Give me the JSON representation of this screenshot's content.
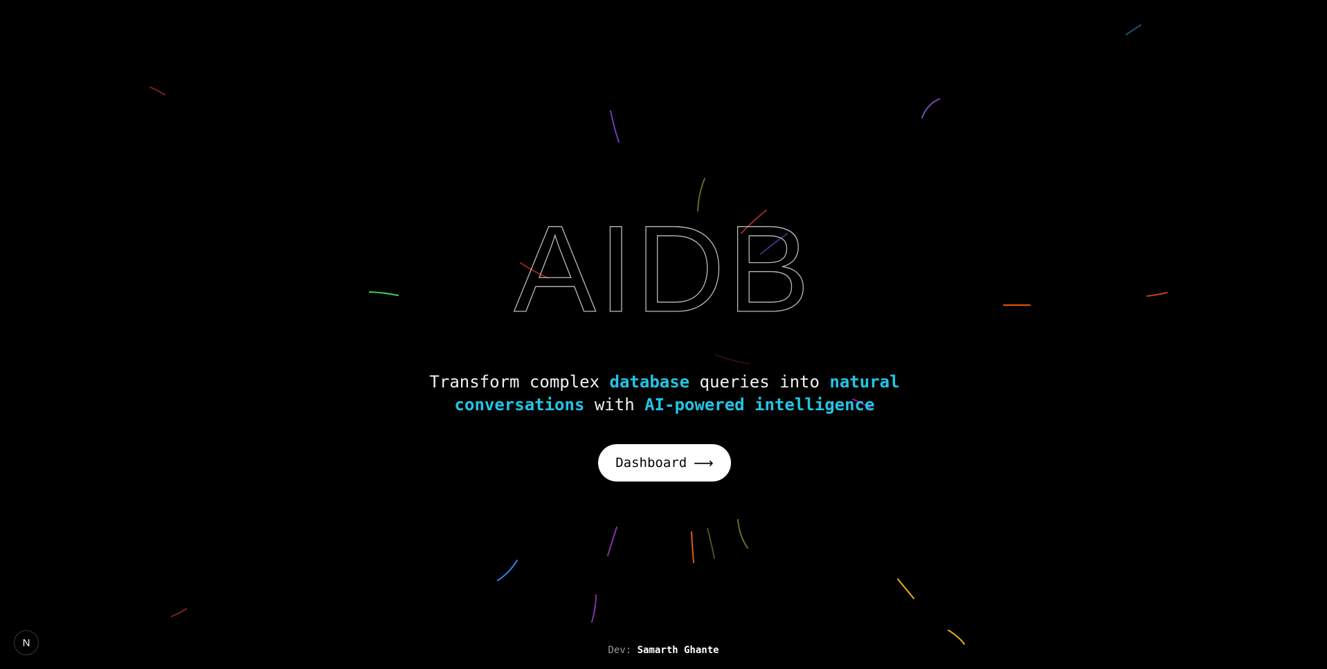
{
  "hero": {
    "title": "AIDB",
    "tagline": {
      "part1": "Transform complex ",
      "hl1": "database",
      "part2": " queries into ",
      "hl2": "natural",
      "hl3": "conversations",
      "part3": " with ",
      "hl4": "AI-powered",
      "hl5": "intelligence"
    },
    "cta_label": "Dashboard",
    "cta_icon": "arrow-right-icon"
  },
  "footer": {
    "credit_prefix": "Dev:",
    "credit_name": "Samarth Ghante"
  },
  "badge": {
    "letter": "N",
    "icon": "nextjs-logo-icon"
  },
  "colors": {
    "background": "#000000",
    "accent": "#22c5e6",
    "title_stroke": "#bdbdbd",
    "button_bg": "#ffffff",
    "button_text": "#000000",
    "streak_colors": [
      "#ef4444",
      "#a855f7",
      "#22c55e",
      "#f97316",
      "#3b82f6",
      "#eab308",
      "#84cc16",
      "#6366f1",
      "#d946ef",
      "#06b6d4"
    ]
  }
}
